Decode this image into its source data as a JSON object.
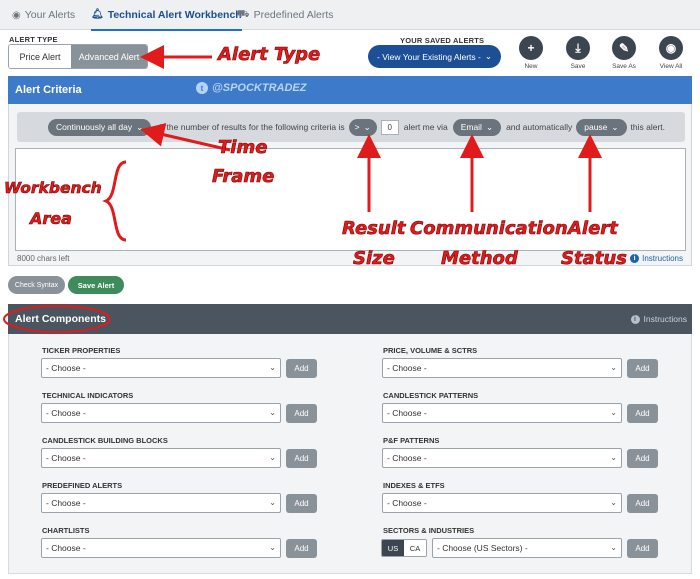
{
  "tabs": [
    {
      "label": "Your Alerts",
      "icon": "eye-icon"
    },
    {
      "label": "Technical Alert Workbench",
      "icon": "bell-icon"
    },
    {
      "label": "Predefined Alerts",
      "icon": "car-icon"
    }
  ],
  "alert_type": {
    "label": "ALERT TYPE",
    "options": [
      "Price Alert",
      "Advanced Alert"
    ],
    "selected": "Advanced Alert"
  },
  "saved_alerts": {
    "label": "YOUR SAVED ALERTS",
    "select_value": "- View Your Existing Alerts -"
  },
  "toolbar": {
    "new_label": "New",
    "save_label": "Save",
    "save_as_label": "Save As",
    "view_all_label": "View All"
  },
  "criteria": {
    "title": "Alert Criteria",
    "watermark": "@SPOCKTRADEZ",
    "frequency": "Continuously all day",
    "text1": ", if the number of results for the following criteria is",
    "operator": ">",
    "count": "0",
    "text2": "alert me via",
    "method": "Email",
    "text3": "and automatically",
    "action": "pause",
    "text4": "this alert.",
    "chars_left": "8000 chars left",
    "instructions": "Instructions"
  },
  "buttons": {
    "check_syntax": "Check Syntax",
    "save_alert": "Save Alert"
  },
  "components": {
    "title": "Alert Components",
    "instructions": "Instructions",
    "choose": "- Choose -",
    "add": "Add",
    "left": [
      "TICKER PROPERTIES",
      "TECHNICAL INDICATORS",
      "CANDLESTICK BUILDING BLOCKS",
      "PREDEFINED ALERTS",
      "CHARTLISTS"
    ],
    "right": [
      "PRICE, VOLUME & SCTRS",
      "CANDLESTICK PATTERNS",
      "P&F PATTERNS",
      "INDEXES & ETFS",
      "SECTORS & INDUSTRIES"
    ],
    "sector_select": "- Choose (US Sectors) -",
    "region_us": "US",
    "region_ca": "CA"
  },
  "annotations": {
    "alert_type": "Alert Type",
    "time_frame_1": "Time",
    "time_frame_2": "Frame",
    "workbench_1": "Workbench",
    "workbench_2": "Area",
    "result_1": "Result",
    "result_2": "Size",
    "comm_1": "Communication",
    "comm_2": "Method",
    "status_1": "Alert",
    "status_2": "Status"
  },
  "colors": {
    "criteria_header": "#3d7ac9",
    "components_header": "#4a5560",
    "annotation": "#e01b1b",
    "save_green": "#3e8b5c"
  }
}
